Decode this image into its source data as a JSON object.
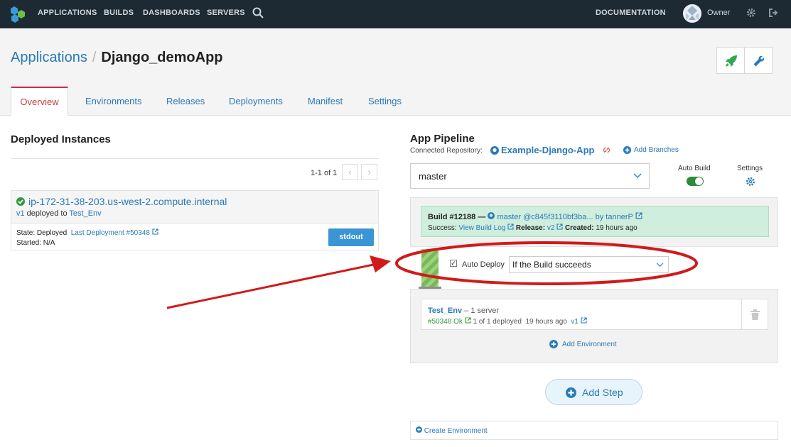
{
  "topnav": {
    "items": [
      "APPLICATIONS",
      "BUILDS",
      "DASHBOARDS",
      "SERVERS"
    ],
    "documentation": "DOCUMENTATION",
    "user": "Owner"
  },
  "header": {
    "breadcrumb_root": "Applications",
    "breadcrumb_sep": "/",
    "title": "Django_demoApp",
    "tabs": [
      "Overview",
      "Environments",
      "Releases",
      "Deployments",
      "Manifest",
      "Settings"
    ],
    "active_tab": "Overview"
  },
  "deployed": {
    "title": "Deployed Instances",
    "pager": "1-1 of 1",
    "instance": {
      "host": "ip-172-31-38-203.us-west-2.compute.internal",
      "release": "v1",
      "deployed_to_text": " deployed to ",
      "env": "Test_Env",
      "state_label": "State: Deployed",
      "last_deployment": "Last Deployment #50348",
      "started": "Started: N/A",
      "stdout": "stdout"
    }
  },
  "pipeline": {
    "title": "App Pipeline",
    "connected_repo_label": "Connected Repository:",
    "repo_name": "Example-Django-App",
    "add_branches": "Add Branches",
    "branch": "master",
    "auto_build_label": "Auto Build",
    "auto_build_on": true,
    "settings_label": "Settings",
    "build": {
      "number": "Build #12188 —",
      "commit": "master @c845f3110bf3ba...",
      "by": "by tannerP",
      "success_label": "Success:",
      "view_log": "View Build Log",
      "release_label": "Release:",
      "release": "v2",
      "created_label": "Created:",
      "created": "19 hours ago"
    },
    "auto_deploy_label": "Auto Deploy",
    "auto_deploy_checked": true,
    "auto_deploy_option": "If the Build succeeds",
    "env": {
      "name": "Test_Env",
      "servers": "– 1 server",
      "deploy_id": "#50348 Ok",
      "deployed_count": "1 of 1 deployed",
      "time": "19 hours ago",
      "release": "v1"
    },
    "add_environment": "Add Environment",
    "add_step": "Add Step",
    "create_environment": "Create Environment"
  },
  "colors": {
    "nav_bg": "#1e2a33",
    "link": "#2a7ab8",
    "success_bg": "#cfeedd",
    "annotation_red": "#d11a1a"
  }
}
